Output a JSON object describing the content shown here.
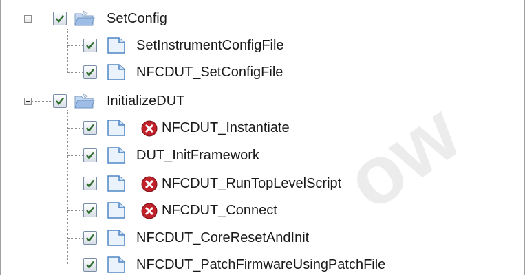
{
  "tree": {
    "groups": [
      {
        "label": "SetConfig",
        "checked": true,
        "expanded": true,
        "icon": "open-folder-icon",
        "children": [
          {
            "label": "SetInstrumentConfigFile",
            "checked": true,
            "icon": "document-icon",
            "error": false
          },
          {
            "label": "NFCDUT_SetConfigFile",
            "checked": true,
            "icon": "document-icon",
            "error": false
          }
        ]
      },
      {
        "label": "InitializeDUT",
        "checked": true,
        "expanded": true,
        "icon": "open-folder-icon",
        "children": [
          {
            "label": "NFCDUT_Instantiate",
            "checked": true,
            "icon": "document-icon",
            "error": true
          },
          {
            "label": "DUT_InitFramework",
            "checked": true,
            "icon": "document-icon",
            "error": false
          },
          {
            "label": "NFCDUT_RunTopLevelScript",
            "checked": true,
            "icon": "document-icon",
            "error": true
          },
          {
            "label": "NFCDUT_Connect",
            "checked": true,
            "icon": "document-icon",
            "error": true
          },
          {
            "label": "NFCDUT_CoreResetAndInit",
            "checked": true,
            "icon": "document-icon",
            "error": false
          },
          {
            "label": "NFCDUT_PatchFirmwareUsingPatchFile",
            "checked": true,
            "icon": "document-icon",
            "error": false
          }
        ]
      }
    ]
  },
  "colors": {
    "error_red": "#c0212b",
    "folder_blue": "#8fb4e3",
    "doc_blue": "#4f86c6",
    "check_green": "#2f6d2f"
  }
}
